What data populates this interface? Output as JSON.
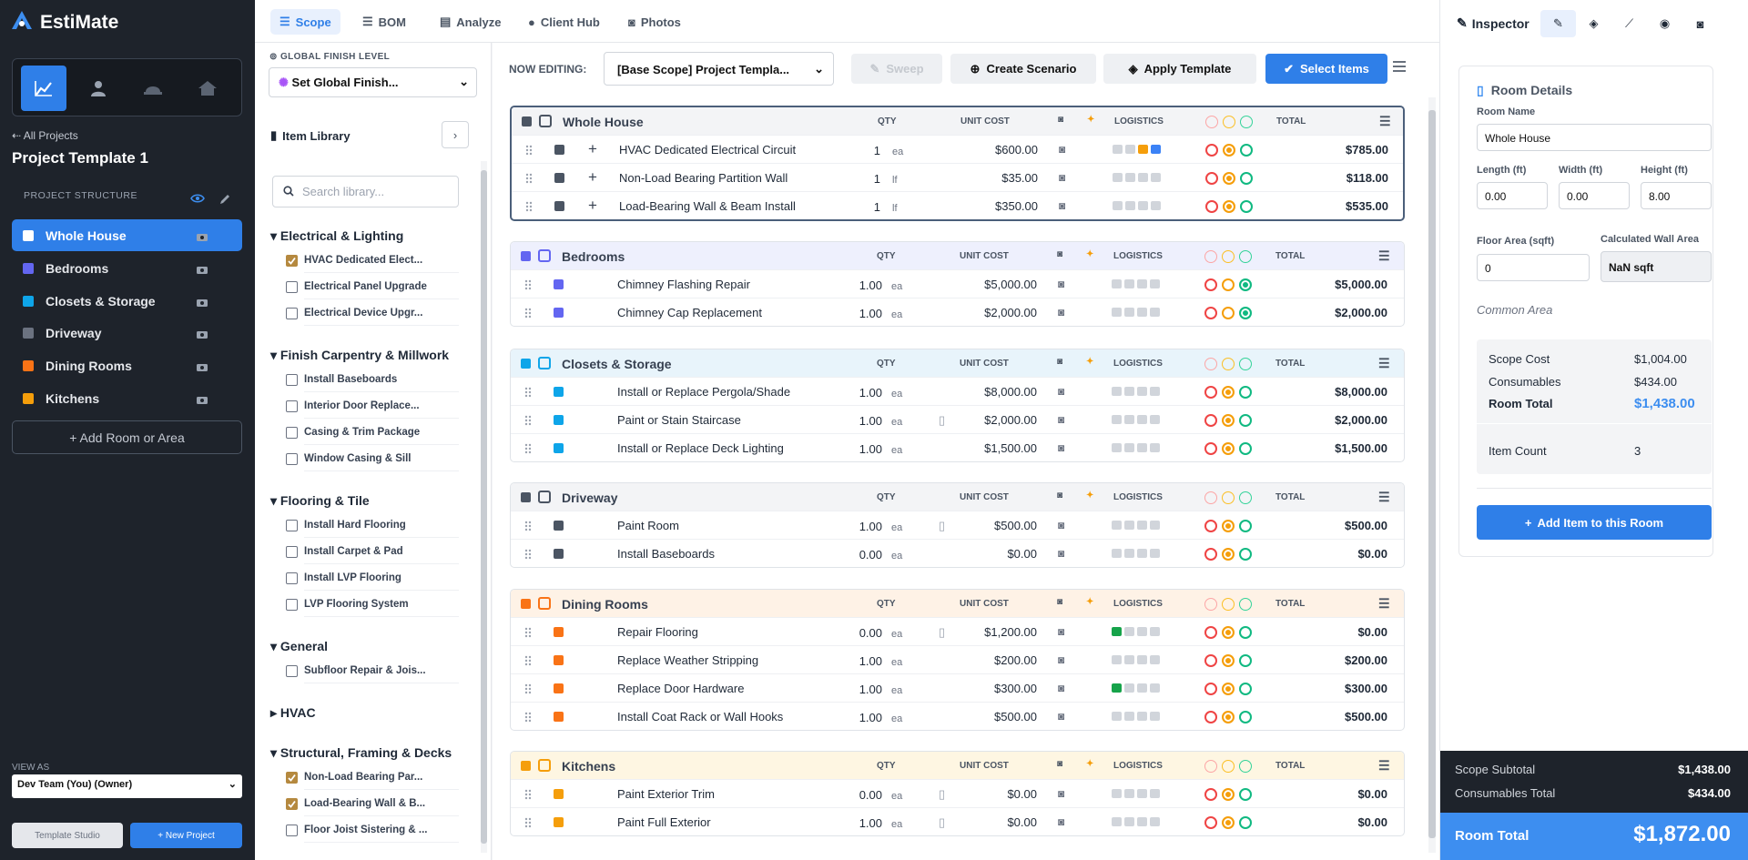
{
  "app": {
    "name": "EstiMate",
    "accent": "#2f7fe8",
    "dark": "#1e232b"
  },
  "sidebar": {
    "back_label": "All Projects",
    "project_title": "Project Template 1",
    "structure_label": "PROJECT STRUCTURE",
    "modes": [
      "chart-icon",
      "person-icon",
      "hardhat-icon",
      "house-icon"
    ],
    "rooms": [
      {
        "label": "Whole House",
        "color": "#6b7280",
        "icon": "door-icon"
      },
      {
        "label": "Bedrooms",
        "color": "#6366f1",
        "icon": "bed-icon"
      },
      {
        "label": "Closets & Storage",
        "color": "#0ea5e9",
        "icon": "closet-icon"
      },
      {
        "label": "Driveway",
        "color": "#6b7280",
        "icon": "door-icon"
      },
      {
        "label": "Dining Rooms",
        "color": "#f97316",
        "icon": "brush-icon"
      },
      {
        "label": "Kitchens",
        "color": "#f59e0b",
        "icon": "utensils-icon"
      }
    ],
    "add_room": "+ Add Room or Area",
    "view_as_label": "VIEW AS",
    "view_as_value": "Dev Team (You) (Owner)",
    "template_studio": "Template Studio",
    "new_project": "+ New Project"
  },
  "tabs": [
    {
      "label": "Scope",
      "icon": "list-icon"
    },
    {
      "label": "BOM",
      "icon": "list-icon"
    },
    {
      "label": "Analyze",
      "icon": "doc-icon"
    },
    {
      "label": "Client Hub",
      "icon": "person-icon"
    },
    {
      "label": "Photos",
      "icon": "camera-icon"
    }
  ],
  "library": {
    "global_label": "GLOBAL FINISH LEVEL",
    "global_value": "Set Global Finish...",
    "title": "Item Library",
    "search_placeholder": "Search library...",
    "categories": [
      {
        "name": "Electrical & Lighting",
        "items": [
          {
            "label": "HVAC Dedicated Elect...",
            "checked": true
          },
          {
            "label": "Electrical Panel Upgrade",
            "checked": false
          },
          {
            "label": "Electrical Device Upgr...",
            "checked": false
          }
        ]
      },
      {
        "name": "Finish Carpentry & Millwork",
        "items": [
          {
            "label": "Install Baseboards",
            "checked": false
          },
          {
            "label": "Interior Door Replace...",
            "checked": false
          },
          {
            "label": "Casing & Trim Package",
            "checked": false
          },
          {
            "label": "Window Casing & Sill",
            "checked": false
          }
        ]
      },
      {
        "name": "Flooring & Tile",
        "items": [
          {
            "label": "Install Hard Flooring",
            "checked": false
          },
          {
            "label": "Install Carpet & Pad",
            "checked": false
          },
          {
            "label": "Install LVP Flooring",
            "checked": false
          },
          {
            "label": "LVP Flooring System",
            "checked": false
          }
        ]
      },
      {
        "name": "General",
        "items": [
          {
            "label": "Subfloor Repair & Jois...",
            "checked": false
          }
        ]
      },
      {
        "name": "HVAC",
        "items": []
      },
      {
        "name": "Structural, Framing & Decks",
        "items": [
          {
            "label": "Non-Load Bearing Par...",
            "checked": true
          },
          {
            "label": "Load-Bearing Wall & B...",
            "checked": true
          },
          {
            "label": "Floor Joist Sistering & ...",
            "checked": false
          }
        ]
      }
    ]
  },
  "toolbar": {
    "now_editing": "NOW EDITING:",
    "scenario": "[Base Scope] Project Templa...",
    "sweep": "Sweep",
    "create_scenario": "Create Scenario",
    "apply_template": "Apply Template",
    "select_items": "Select Items"
  },
  "columns": {
    "qty": "QTY",
    "unit_cost": "UNIT COST",
    "logistics": "LOGISTICS",
    "total": "TOTAL"
  },
  "groups": [
    {
      "name": "Whole House",
      "color": "#4b5563",
      "bg": "#f3f4f6",
      "items": [
        {
          "name": "HVAC Dedicated Electrical Circuit",
          "qty": "1",
          "unit": "ea",
          "cost": "$600.00",
          "total": "$785.00",
          "plus": true
        },
        {
          "name": "Non-Load Bearing Partition Wall",
          "qty": "1",
          "unit": "lf",
          "cost": "$35.00",
          "total": "$118.00",
          "plus": true
        },
        {
          "name": "Load-Bearing Wall & Beam Install",
          "qty": "1",
          "unit": "lf",
          "cost": "$350.00",
          "total": "$535.00",
          "plus": true
        }
      ]
    },
    {
      "name": "Bedrooms",
      "color": "#6366f1",
      "bg": "#eef0fd",
      "items": [
        {
          "name": "Chimney Flashing Repair",
          "qty": "1.00",
          "unit": "ea",
          "cost": "$5,000.00",
          "total": "$5,000.00"
        },
        {
          "name": "Chimney Cap Replacement",
          "qty": "1.00",
          "unit": "ea",
          "cost": "$2,000.00",
          "total": "$2,000.00"
        }
      ]
    },
    {
      "name": "Closets & Storage",
      "color": "#0ea5e9",
      "bg": "#e8f4fb",
      "items": [
        {
          "name": "Install or Replace Pergola/Shade",
          "qty": "1.00",
          "unit": "ea",
          "cost": "$8,000.00",
          "total": "$8,000.00"
        },
        {
          "name": "Paint or Stain Staircase",
          "qty": "1.00",
          "unit": "ea",
          "cost": "$2,000.00",
          "total": "$2,000.00",
          "note": true
        },
        {
          "name": "Install or Replace Deck Lighting",
          "qty": "1.00",
          "unit": "ea",
          "cost": "$1,500.00",
          "total": "$1,500.00"
        }
      ]
    },
    {
      "name": "Driveway",
      "color": "#4b5563",
      "bg": "#f3f4f6",
      "items": [
        {
          "name": "Paint Room",
          "qty": "1.00",
          "unit": "ea",
          "cost": "$500.00",
          "total": "$500.00",
          "note": true
        },
        {
          "name": "Install Baseboards",
          "qty": "0.00",
          "unit": "ea",
          "cost": "$0.00",
          "total": "$0.00"
        }
      ]
    },
    {
      "name": "Dining Rooms",
      "color": "#f97316",
      "bg": "#fef2e6",
      "items": [
        {
          "name": "Repair Flooring",
          "qty": "0.00",
          "unit": "ea",
          "cost": "$1,200.00",
          "total": "$0.00",
          "note": true,
          "green": true
        },
        {
          "name": "Replace Weather Stripping",
          "qty": "1.00",
          "unit": "ea",
          "cost": "$200.00",
          "total": "$200.00"
        },
        {
          "name": "Replace Door Hardware",
          "qty": "1.00",
          "unit": "ea",
          "cost": "$300.00",
          "total": "$300.00",
          "green": true
        },
        {
          "name": "Install Coat Rack or Wall Hooks",
          "qty": "1.00",
          "unit": "ea",
          "cost": "$500.00",
          "total": "$500.00"
        }
      ]
    },
    {
      "name": "Kitchens",
      "color": "#f59e0b",
      "bg": "#fef6e2",
      "items": [
        {
          "name": "Paint Exterior Trim",
          "qty": "0.00",
          "unit": "ea",
          "cost": "$0.00",
          "total": "$0.00",
          "note": true
        },
        {
          "name": "Paint Full Exterior",
          "qty": "1.00",
          "unit": "ea",
          "cost": "$0.00",
          "total": "$0.00",
          "note": true
        }
      ]
    }
  ],
  "inspector": {
    "title": "Inspector",
    "section": "Room Details",
    "room_name_label": "Room Name",
    "room_name": "Whole House",
    "length_label": "Length (ft)",
    "length": "0.00",
    "width_label": "Width (ft)",
    "width": "0.00",
    "height_label": "Height (ft)",
    "height": "8.00",
    "floor_area_label": "Floor Area (sqft)",
    "floor_area": "0",
    "wall_area_label": "Calculated Wall Area",
    "wall_area": "NaN sqft",
    "common_area": "Common Area",
    "scope_cost_label": "Scope Cost",
    "scope_cost": "$1,004.00",
    "consumables_label": "Consumables",
    "consumables": "$434.00",
    "room_total_label": "Room Total",
    "room_total": "$1,438.00",
    "item_count_label": "Item Count",
    "item_count": "3",
    "add_item": "Add Item to this Room"
  },
  "footer": {
    "scope_subtotal_label": "Scope Subtotal",
    "scope_subtotal": "$1,438.00",
    "consumables_total_label": "Consumables Total",
    "consumables_total": "$434.00",
    "room_total_label": "Room Total",
    "room_total": "$1,872.00"
  }
}
